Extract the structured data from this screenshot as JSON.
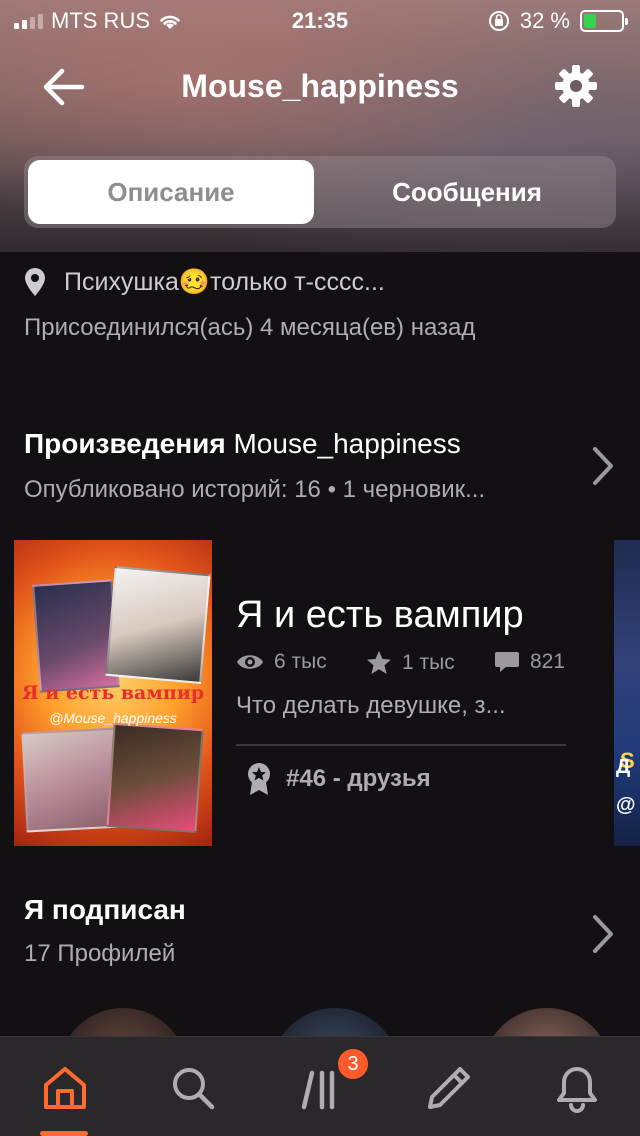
{
  "status_bar": {
    "carrier": "MTS RUS",
    "time": "21:35",
    "battery_percent": "32 %",
    "battery_level": 0.32
  },
  "nav": {
    "title": "Mouse_happiness",
    "back_icon": "arrow-left-icon",
    "settings_icon": "gear-icon"
  },
  "tabs": {
    "about": "Описание",
    "messages": "Сообщения",
    "active": "about"
  },
  "profile": {
    "location_before": "Психушка",
    "location_emoji": "🥴",
    "location_after": "только т-сссс...",
    "joined": "Присоединился(ась) 4 месяца(ев) назад"
  },
  "works": {
    "title": "Произведения",
    "username": "Mouse_happiness",
    "subtitle": "Опубликовано историй: 16 • 1 черновик..."
  },
  "story": {
    "cover_title": "Я и есть вампир",
    "cover_author": "@Mouse_happiness",
    "title": "Я и есть вампир",
    "reads": "6 тыс",
    "votes": "1 тыс",
    "comments": "821",
    "description": "Что делать девушке, з...",
    "rank": "#46 - друзья"
  },
  "next_cover": {
    "text1": "S",
    "text2": "Д",
    "text3": "@"
  },
  "following": {
    "title": "Я подписан",
    "count": "17 Профилей"
  },
  "tabbar": {
    "items": [
      "home-icon",
      "search-icon",
      "library-icon",
      "write-icon",
      "bell-icon"
    ],
    "library_badge": "3",
    "accent": "#ff6b2e"
  }
}
